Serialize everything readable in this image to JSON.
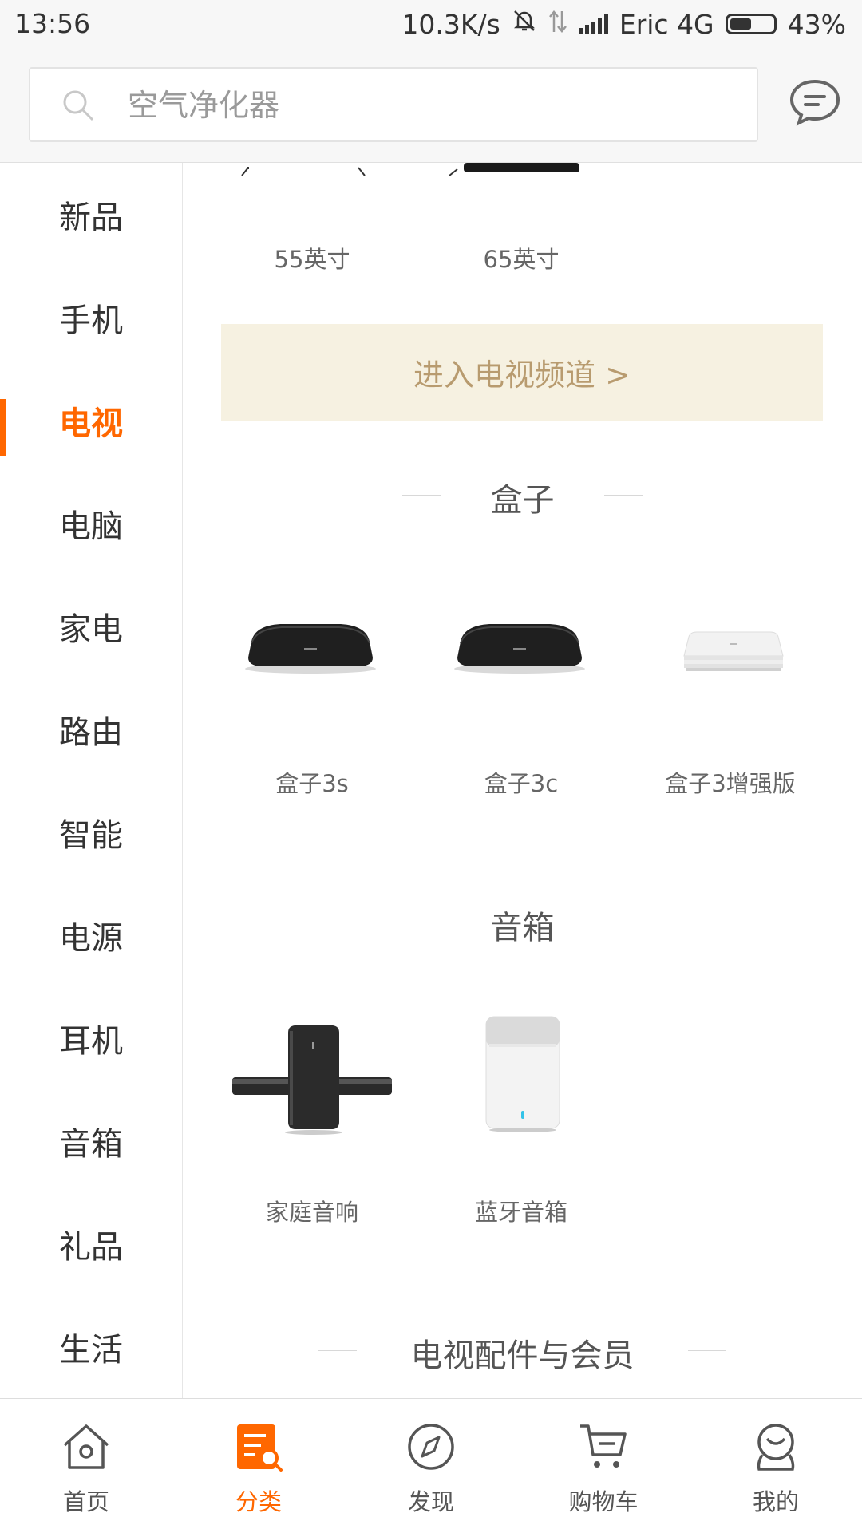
{
  "status_bar": {
    "time": "13:56",
    "speed": "10.3K/s",
    "carrier": "Eric 4G",
    "battery": "43%"
  },
  "search": {
    "placeholder": "空气净化器"
  },
  "sidebar": {
    "active_index": 2,
    "items": [
      {
        "label": "新品"
      },
      {
        "label": "手机"
      },
      {
        "label": "电视"
      },
      {
        "label": "电脑"
      },
      {
        "label": "家电"
      },
      {
        "label": "路由"
      },
      {
        "label": "智能"
      },
      {
        "label": "电源"
      },
      {
        "label": "耳机"
      },
      {
        "label": "音箱"
      },
      {
        "label": "礼品"
      },
      {
        "label": "生活"
      }
    ]
  },
  "tv_partial": {
    "items": [
      {
        "label": "55英寸"
      },
      {
        "label": "65英寸"
      }
    ]
  },
  "channel_banner": "进入电视频道 >",
  "sections": [
    {
      "title": "盒子",
      "items": [
        {
          "label": "盒子3s",
          "icon": "black-box-icon"
        },
        {
          "label": "盒子3c",
          "icon": "black-box-icon"
        },
        {
          "label": "盒子3增强版",
          "icon": "white-box-icon"
        }
      ]
    },
    {
      "title": "音箱",
      "items": [
        {
          "label": "家庭音响",
          "icon": "soundbar-icon"
        },
        {
          "label": "蓝牙音箱",
          "icon": "cylinder-speaker-icon"
        }
      ]
    },
    {
      "title": "电视配件与会员",
      "items": []
    }
  ],
  "bottom_nav": {
    "active_index": 1,
    "items": [
      {
        "label": "首页",
        "icon": "home-icon"
      },
      {
        "label": "分类",
        "icon": "category-icon"
      },
      {
        "label": "发现",
        "icon": "compass-icon"
      },
      {
        "label": "购物车",
        "icon": "cart-icon"
      },
      {
        "label": "我的",
        "icon": "profile-icon"
      }
    ]
  },
  "colors": {
    "accent": "#ff6700",
    "banner_bg": "#f6f1e1",
    "banner_text": "#b89b6f"
  }
}
